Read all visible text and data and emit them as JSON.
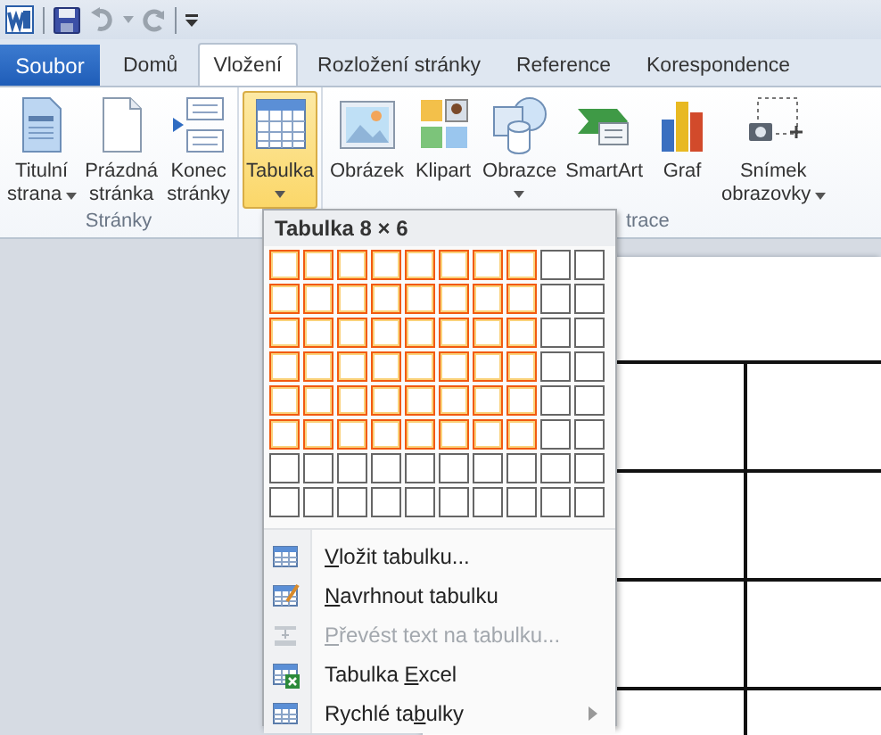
{
  "tabs": [
    {
      "label": "Soubor",
      "kind": "file",
      "selected": false
    },
    {
      "label": "Domů",
      "kind": "tab",
      "selected": false
    },
    {
      "label": "Vložení",
      "kind": "tab",
      "selected": true
    },
    {
      "label": "Rozložení stránky",
      "kind": "tab",
      "selected": false
    },
    {
      "label": "Reference",
      "kind": "tab",
      "selected": false
    },
    {
      "label": "Korespondence",
      "kind": "tab",
      "selected": false
    }
  ],
  "groups": [
    {
      "label": "Stránky",
      "buttons": [
        {
          "lines": [
            "Titulní",
            "strana"
          ],
          "kind": "inline",
          "pressed": false
        },
        {
          "lines": [
            "Prázdná",
            "stránka"
          ],
          "kind": "plain",
          "pressed": false
        },
        {
          "lines": [
            "Konec",
            "stránky"
          ],
          "kind": "plain",
          "pressed": false
        }
      ]
    },
    {
      "buttons": [
        {
          "lines": [
            "Tabulka"
          ],
          "kind": "below",
          "pressed": true
        }
      ]
    },
    {
      "label": "trace",
      "buttons": [
        {
          "lines": [
            "Obrázek"
          ],
          "kind": "plain",
          "pressed": false
        },
        {
          "lines": [
            "Klipart"
          ],
          "kind": "plain",
          "pressed": false
        },
        {
          "lines": [
            "Obrazce"
          ],
          "kind": "below",
          "pressed": false
        },
        {
          "lines": [
            "SmartArt"
          ],
          "kind": "plain",
          "pressed": false
        },
        {
          "lines": [
            "Graf"
          ],
          "kind": "plain",
          "pressed": false
        },
        {
          "lines": [
            "Snímek",
            "obrazovky"
          ],
          "kind": "inline",
          "pressed": false
        }
      ]
    }
  ],
  "table_menu": {
    "title": "Tabulka 8 × 6",
    "grid": [
      [
        {
          "selected": true
        },
        {
          "selected": true
        },
        {
          "selected": true
        },
        {
          "selected": true
        },
        {
          "selected": true
        },
        {
          "selected": true
        },
        {
          "selected": true
        },
        {
          "selected": true
        },
        {
          "selected": false
        },
        {
          "selected": false
        }
      ],
      [
        {
          "selected": true
        },
        {
          "selected": true
        },
        {
          "selected": true
        },
        {
          "selected": true
        },
        {
          "selected": true
        },
        {
          "selected": true
        },
        {
          "selected": true
        },
        {
          "selected": true
        },
        {
          "selected": false
        },
        {
          "selected": false
        }
      ],
      [
        {
          "selected": true
        },
        {
          "selected": true
        },
        {
          "selected": true
        },
        {
          "selected": true
        },
        {
          "selected": true
        },
        {
          "selected": true
        },
        {
          "selected": true
        },
        {
          "selected": true
        },
        {
          "selected": false
        },
        {
          "selected": false
        }
      ],
      [
        {
          "selected": true
        },
        {
          "selected": true
        },
        {
          "selected": true
        },
        {
          "selected": true
        },
        {
          "selected": true
        },
        {
          "selected": true
        },
        {
          "selected": true
        },
        {
          "selected": true
        },
        {
          "selected": false
        },
        {
          "selected": false
        }
      ],
      [
        {
          "selected": true
        },
        {
          "selected": true
        },
        {
          "selected": true
        },
        {
          "selected": true
        },
        {
          "selected": true
        },
        {
          "selected": true
        },
        {
          "selected": true
        },
        {
          "selected": true
        },
        {
          "selected": false
        },
        {
          "selected": false
        }
      ],
      [
        {
          "selected": true
        },
        {
          "selected": true
        },
        {
          "selected": true
        },
        {
          "selected": true
        },
        {
          "selected": true
        },
        {
          "selected": true
        },
        {
          "selected": true
        },
        {
          "selected": true
        },
        {
          "selected": false
        },
        {
          "selected": false
        }
      ],
      [
        {
          "selected": false
        },
        {
          "selected": false
        },
        {
          "selected": false
        },
        {
          "selected": false
        },
        {
          "selected": false
        },
        {
          "selected": false
        },
        {
          "selected": false
        },
        {
          "selected": false
        },
        {
          "selected": false
        },
        {
          "selected": false
        }
      ],
      [
        {
          "selected": false
        },
        {
          "selected": false
        },
        {
          "selected": false
        },
        {
          "selected": false
        },
        {
          "selected": false
        },
        {
          "selected": false
        },
        {
          "selected": false
        },
        {
          "selected": false
        },
        {
          "selected": false
        },
        {
          "selected": false
        }
      ]
    ],
    "items": [
      {
        "key": "V",
        "post": "ložit tabulku...",
        "disabled": false,
        "submenu": false
      },
      {
        "key": "N",
        "post": "avrhnout tabulku",
        "disabled": false,
        "submenu": false
      },
      {
        "key": "P",
        "post": "řevést text na tabulku...",
        "disabled": true,
        "submenu": false
      },
      {
        "pre": "Tabulka ",
        "key": "E",
        "post": "xcel",
        "disabled": false,
        "submenu": false
      },
      {
        "pre": "Rychlé ta",
        "key": "b",
        "post": "ulky",
        "disabled": false,
        "submenu": true
      }
    ]
  }
}
